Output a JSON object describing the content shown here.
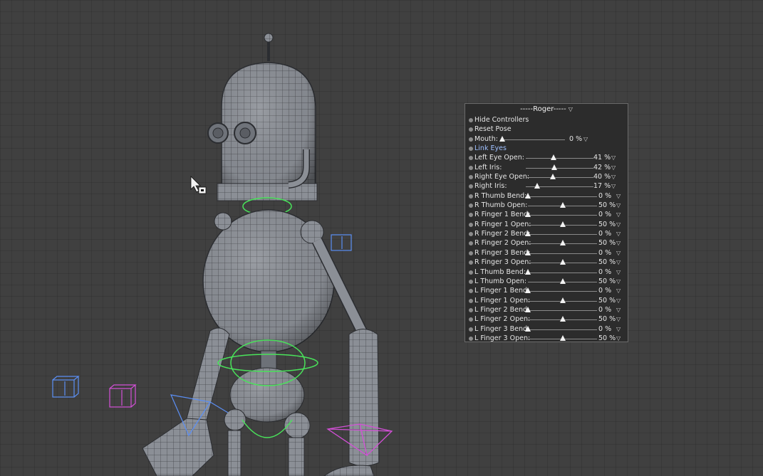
{
  "panel": {
    "title": "-----Roger-----",
    "title_icon": "chevron-down-icon",
    "buttons": [
      {
        "label": "Hide Controllers"
      },
      {
        "label": "Reset Pose"
      }
    ],
    "link_label": "Link Eyes",
    "sliders": [
      {
        "label": "Mouth:",
        "value": "0 %",
        "level": 0,
        "group": "mouth"
      },
      {
        "label": "Left Eye Open:",
        "value": "41 %",
        "level": 0.41,
        "group": "eye"
      },
      {
        "label": "Left Iris:",
        "value": "42 %",
        "level": 0.42,
        "group": "eye"
      },
      {
        "label": "Right Eye Open:",
        "value": "40 %",
        "level": 0.4,
        "group": "eye"
      },
      {
        "label": "Right Iris:",
        "value": "17 %",
        "level": 0.17,
        "group": "eye"
      },
      {
        "label": "R Thumb Bend:",
        "value": "0 %",
        "level": 0,
        "group": "hand"
      },
      {
        "label": "R Thumb Open:",
        "value": "50 %",
        "level": 0.5,
        "group": "hand"
      },
      {
        "label": "R Finger 1 Bend:",
        "value": "0 %",
        "level": 0,
        "group": "hand"
      },
      {
        "label": "R Finger 1 Open:",
        "value": "50 %",
        "level": 0.5,
        "group": "hand"
      },
      {
        "label": "R Finger 2 Bend:",
        "value": "0 %",
        "level": 0,
        "group": "hand"
      },
      {
        "label": "R Finger 2 Open:",
        "value": "50 %",
        "level": 0.5,
        "group": "hand"
      },
      {
        "label": "R Finger 3 Bend:",
        "value": "0 %",
        "level": 0,
        "group": "hand"
      },
      {
        "label": "R Finger 3 Open:",
        "value": "50 %",
        "level": 0.5,
        "group": "hand"
      },
      {
        "label": "L Thumb Bend:",
        "value": "0 %",
        "level": 0,
        "group": "hand"
      },
      {
        "label": "L Thumb Open:",
        "value": "50 %",
        "level": 0.5,
        "group": "hand"
      },
      {
        "label": "L Finger 1 Bend:",
        "value": "0 %",
        "level": 0,
        "group": "hand"
      },
      {
        "label": "L Finger 1 Open:",
        "value": "50 %",
        "level": 0.5,
        "group": "hand"
      },
      {
        "label": "L Finger 2 Bend:",
        "value": "0 %",
        "level": 0,
        "group": "hand"
      },
      {
        "label": "L Finger 2 Open:",
        "value": "50 %",
        "level": 0.5,
        "group": "hand"
      },
      {
        "label": "L Finger 3 Bend:",
        "value": "0 %",
        "level": 0,
        "group": "hand"
      },
      {
        "label": "L Finger 3 Open:",
        "value": "50 %",
        "level": 0.5,
        "group": "hand"
      }
    ]
  },
  "viewport": {
    "cursor_icon": "move-cursor-icon",
    "colors": {
      "background": "#404040",
      "mesh_fill": "#8b8f96",
      "wire": "#2b2d31",
      "controller_green": "#49e35a",
      "controller_blue": "#5b8ff5",
      "controller_magenta": "#d24fd6"
    }
  }
}
